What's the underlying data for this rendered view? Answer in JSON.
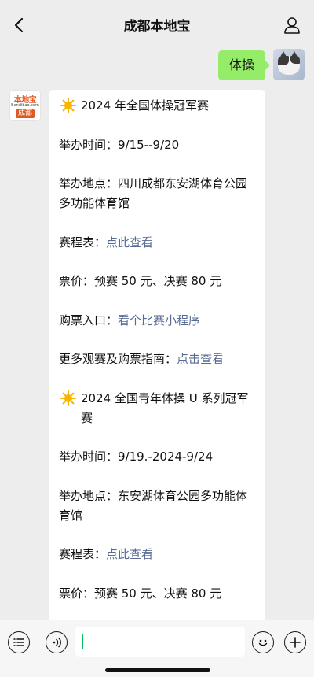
{
  "header": {
    "title": "成都本地宝",
    "back_icon": "chevron-left-icon",
    "profile_icon": "person-icon"
  },
  "my_message": {
    "text": "体操"
  },
  "bot": {
    "logo": {
      "brand": "本地宝",
      "url": "Bendibao.com",
      "city": "成都"
    }
  },
  "reply": {
    "event1": {
      "heading": "2024 年全国体操冠军赛",
      "time": "举办时间：9/15--9/20",
      "venue": "举办地点：四川成都东安湖体育公园多功能体育馆",
      "schedule_label": "赛程表：",
      "schedule_link": "点此查看",
      "price": "票价：预赛 50 元、决赛 80 元",
      "ticket_label": "购票入口：",
      "ticket_link": "看个比赛小程序",
      "guide_label": "更多观赛及购票指南：",
      "guide_link": "点击查看"
    },
    "event2": {
      "heading": "2024 全国青年体操 U 系列冠军赛",
      "time": "举办时间：9/19.-2024-9/24",
      "venue": "举办地点：东安湖体育公园多功能体育馆",
      "schedule_label": "赛程表：",
      "schedule_link": "点此查看",
      "price": "票价：预赛 50 元、决赛 80 元"
    }
  },
  "input": {
    "value": ""
  },
  "colors": {
    "bubble_me": "#95ec69",
    "link": "#576b95",
    "caret": "#07c160",
    "background": "#ededed"
  }
}
